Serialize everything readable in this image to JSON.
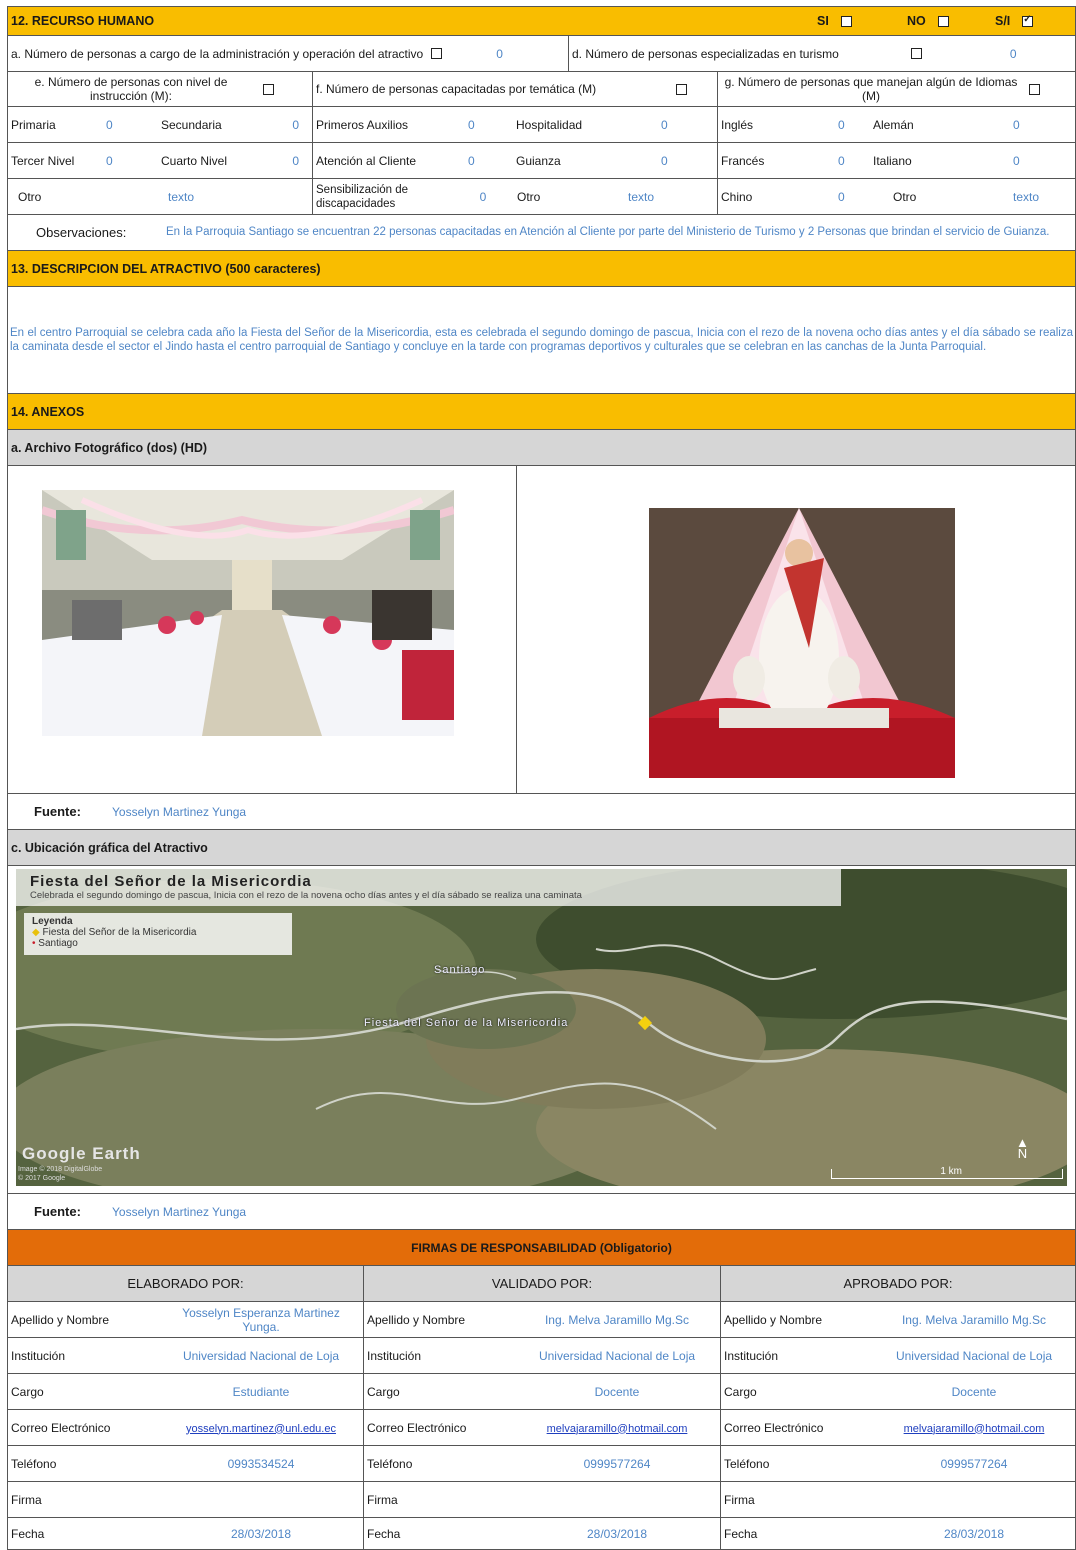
{
  "rh": {
    "title": "12. RECURSO HUMANO",
    "si": "SI",
    "no": "NO",
    "si_label": "S/I",
    "a_label": "a. Número de personas a cargo de la administración y operación del atractivo",
    "a_val": "0",
    "d_label": "d. Número de personas especializadas en turismo",
    "d_val": "0",
    "e_label": "e. Número de personas con nivel de instrucción (M):",
    "f_label": "f. Número de personas capacitadas por temática (M)",
    "g_label": "g. Número de personas que manejan algún de Idiomas (M)",
    "r1": [
      "Primaria",
      "0",
      "Secundaria",
      "0",
      "Primeros Auxilios",
      "0",
      "Hospitalidad",
      "0",
      "Inglés",
      "0",
      "Alemán",
      "0"
    ],
    "r2": [
      "Tercer Nivel",
      "0",
      "Cuarto Nivel",
      "0",
      "Atención al Cliente",
      "0",
      "Guianza",
      "0",
      "Francés",
      "0",
      "Italiano",
      "0"
    ],
    "r3": [
      "Otro",
      "texto",
      "Sensibilización de discapacidades",
      "0",
      "Otro",
      "texto",
      "Chino",
      "0",
      "Otro",
      "texto"
    ],
    "obs_label": "Observaciones:",
    "obs_text": "En la Parroquia Santiago se encuentran 22 personas capacitadas en Atención al Cliente por parte del Ministerio de Turismo y 2 Personas que brindan el servicio de Guianza."
  },
  "desc": {
    "title": "13. DESCRIPCION DEL ATRACTIVO (500 caracteres)",
    "text": "En el centro Parroquial se celebra cada año la Fiesta del Señor de la Misericordia, esta es celebrada el segundo domingo de pascua, Inicia con el rezo de la novena ocho días antes y el día sábado se realiza la caminata desde el sector el Jindo hasta el centro parroquial de Santiago y concluye en la tarde con programas deportivos y culturales que se celebran en las canchas de la Junta Parroquial."
  },
  "anexos": {
    "title": "14. ANEXOS",
    "photo_title": "a. Archivo Fotográfico (dos) (HD)",
    "fuente_label": "Fuente:",
    "fuente_val": "Yosselyn Martinez Yunga",
    "map_section": "c. Ubicación gráfica del Atractivo",
    "map_title": "Fiesta del Señor de la Misericordia",
    "map_sub": "Celebrada el segundo domingo de pascua, Inicia con el rezo de la novena ocho días antes y el día sábado se realiza una caminata",
    "legend_title": "Leyenda",
    "legend_1": "Fiesta del Señor de la Misericordia",
    "legend_2": "Santiago",
    "place_santiago": "Santiago",
    "place_fiesta": "Fiesta del Señor de la Misericordia",
    "ge": "Google Earth",
    "credit_1": "Image © 2018 DigitalGlobe",
    "credit_2": "© 2017 Google",
    "scale": "1 km",
    "north": "N"
  },
  "firmas": {
    "title": "FIRMAS DE RESPONSABILIDAD (Obligatorio)",
    "cols": [
      {
        "head": "ELABORADO POR:",
        "nombre": "Yosselyn Esperanza Martinez Yunga.",
        "inst": "Universidad Nacional de Loja",
        "cargo": "Estudiante",
        "correo": "yosselyn.martinez@unl.edu.ec",
        "tel": "0993534524",
        "fecha": "28/03/2018"
      },
      {
        "head": "VALIDADO  POR:",
        "nombre": "Ing. Melva Jaramillo Mg.Sc",
        "inst": "Universidad Nacional de Loja",
        "cargo": "Docente",
        "correo": "melvajaramillo@hotmail.com",
        "tel": "0999577264",
        "fecha": "28/03/2018"
      },
      {
        "head": "APROBADO POR:",
        "nombre": "Ing. Melva Jaramillo Mg.Sc",
        "inst": "Universidad Nacional de Loja",
        "cargo": "Docente",
        "correo": "melvajaramillo@hotmail.com",
        "tel": "0999577264",
        "fecha": "28/03/2018"
      }
    ],
    "labels": {
      "nombre": "Apellido y Nombre",
      "inst": "Institución",
      "cargo": "Cargo",
      "correo": "Correo Electrónico",
      "tel": "Teléfono",
      "firma": "Firma",
      "fecha": "Fecha"
    }
  }
}
